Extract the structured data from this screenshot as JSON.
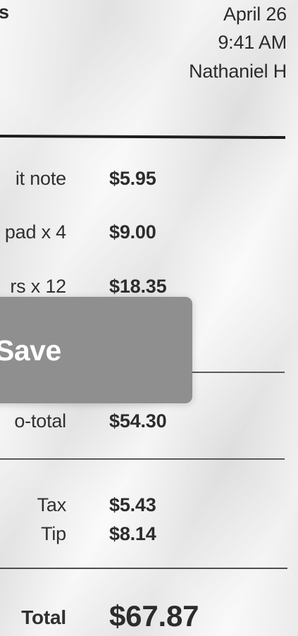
{
  "receipt": {
    "header": {
      "store_fragment": "s",
      "date": "April 26",
      "time": "9:41 AM",
      "server": "Nathaniel H"
    },
    "items": [
      {
        "label": "it note",
        "price": "$5.95"
      },
      {
        "label": "pad x 4",
        "price": "$9.00"
      },
      {
        "label": "rs x 12",
        "price": "$18.35"
      }
    ],
    "subtotal": {
      "label": "o-total",
      "value": "$54.30"
    },
    "tax": {
      "label": "Tax",
      "value": "$5.43"
    },
    "tip": {
      "label": "Tip",
      "value": "$8.14"
    },
    "total": {
      "label": "Total",
      "value": "$67.87"
    }
  },
  "overlay": {
    "save_label": "Save"
  }
}
